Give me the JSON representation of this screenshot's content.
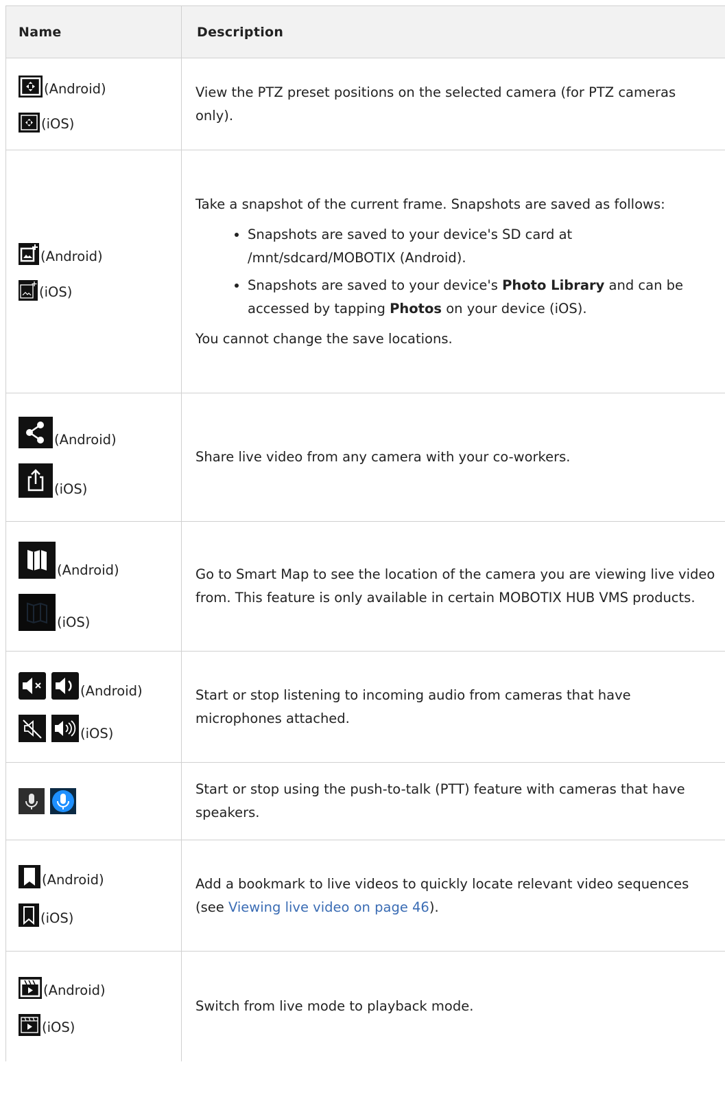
{
  "header": {
    "name": "Name",
    "description": "Description"
  },
  "rows": [
    {
      "android_label": "(Android)",
      "ios_label": "(iOS)",
      "description": "View the PTZ preset positions on the selected camera (for PTZ cameras only)."
    },
    {
      "android_label": "(Android)",
      "ios_label": "(iOS)",
      "intro": "Take a snapshot of the current frame. Snapshots are saved as follows:",
      "bullet_1": "Snapshots are saved to your device's SD card at /mnt/sdcard/MOBOTIX (Android).",
      "bullet_2_a": "Snapshots are saved to your device's ",
      "bullet_2_b": "Photo Library",
      "bullet_2_c": " and can be accessed by tapping ",
      "bullet_2_d": "Photos",
      "bullet_2_e": " on your device (iOS).",
      "outro": "You cannot change the save locations."
    },
    {
      "android_label": "(Android)",
      "ios_label": "(iOS)",
      "description": "Share live video from any camera with your co-workers."
    },
    {
      "android_label": "(Android)",
      "ios_label": "(iOS)",
      "description": "Go to Smart Map to see the location of the camera you are viewing live video from. This feature is only available in certain MOBOTIX HUB VMS products."
    },
    {
      "android_label": "(Android)",
      "ios_label": "(iOS)",
      "description": "Start or stop listening to incoming audio from cameras that have microphones attached."
    },
    {
      "description": "Start or stop using the push-to-talk (PTT) feature with cameras that have speakers."
    },
    {
      "android_label": "(Android)",
      "ios_label": "(iOS)",
      "desc_a": "Add a bookmark to live videos to quickly locate relevant video sequences (see ",
      "link": "Viewing live video on page 46",
      "desc_b": ")."
    },
    {
      "android_label": "(Android)",
      "ios_label": "(iOS)",
      "description": "Switch from live mode to playback mode."
    }
  ],
  "colors": {
    "link": "#3a6cb4",
    "header_bg": "#f2f2f2",
    "border": "#d0d0d0",
    "mic_active": "#1e90ff"
  }
}
